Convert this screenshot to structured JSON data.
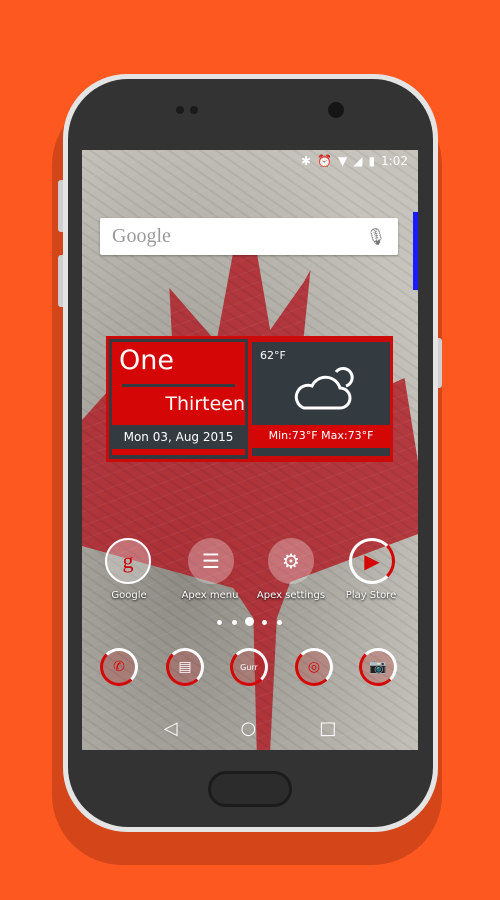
{
  "colors": {
    "background": "#fd5820",
    "widget_red": "#d40606",
    "widget_dark": "#333a40"
  },
  "status_bar": {
    "icons": [
      "bluetooth-icon",
      "alarm-icon",
      "wifi-icon",
      "signal-icon",
      "battery-charging-icon"
    ],
    "time": "1:02"
  },
  "search": {
    "logo": "Google",
    "mic_icon": "mic-icon"
  },
  "clock_widget": {
    "hour": "One",
    "minute": "Thirteen",
    "date": "Mon 03, Aug 2015"
  },
  "weather_widget": {
    "temp": "62°F",
    "icon": "partly-cloudy-icon",
    "minmax": "Min:73°F Max:73°F"
  },
  "apps": [
    {
      "label": "Google"
    },
    {
      "label": "Apex menu"
    },
    {
      "label": "Apex settings"
    },
    {
      "label": "Play Store"
    }
  ],
  "page_indicator": {
    "pages": 5,
    "current": 3
  },
  "dock": [
    {
      "name": "phone"
    },
    {
      "name": "messages"
    },
    {
      "name": "gurr"
    },
    {
      "name": "chrome"
    },
    {
      "name": "camera"
    }
  ],
  "dock_text": "Gurr",
  "nav": {
    "back": "◁",
    "home": "○",
    "recents": "□"
  }
}
